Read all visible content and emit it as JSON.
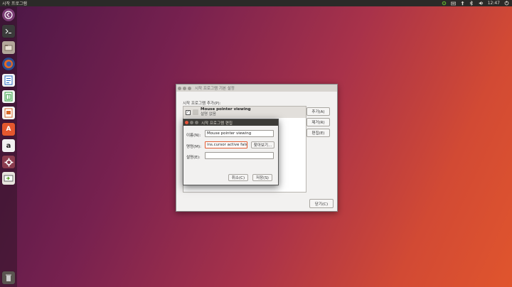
{
  "topbar": {
    "title": "시작 프로그램",
    "time": "12:47",
    "icons": [
      "update-icon",
      "keyboard-indicator-icon",
      "network-icon",
      "bluetooth-icon",
      "volume-icon",
      "power-icon"
    ]
  },
  "launcher": {
    "items": [
      "dash-icon",
      "terminal-icon",
      "files-icon",
      "firefox-icon",
      "writer-icon",
      "calc-icon",
      "impress-icon",
      "software-center-icon",
      "amazon-icon",
      "settings-icon",
      "startup-applications-icon",
      "trash-icon"
    ]
  },
  "main_dialog": {
    "title": "시작 프로그램 기본 설정",
    "list_label": "시작 프로그램 추가(P):",
    "items": [
      {
        "name": "Mouse pointer viewing",
        "description": "설명 없음",
        "checked": true
      }
    ],
    "add_label": "추가(A)",
    "remove_label": "제거(R)",
    "edit_label": "편집(E)",
    "close_label": "닫기(C)"
  },
  "edit_dialog": {
    "title": "시작 프로그램 편집",
    "name_label": "이름(N):",
    "name_value": "Mouse pointer viewing",
    "command_label": "명령(M):",
    "command_value": "ins.cursor active false",
    "browse_label": "찾아보기...",
    "comment_label": "설명(E):",
    "comment_value": "",
    "cancel_label": "취소(C)",
    "save_label": "저장(S)"
  }
}
